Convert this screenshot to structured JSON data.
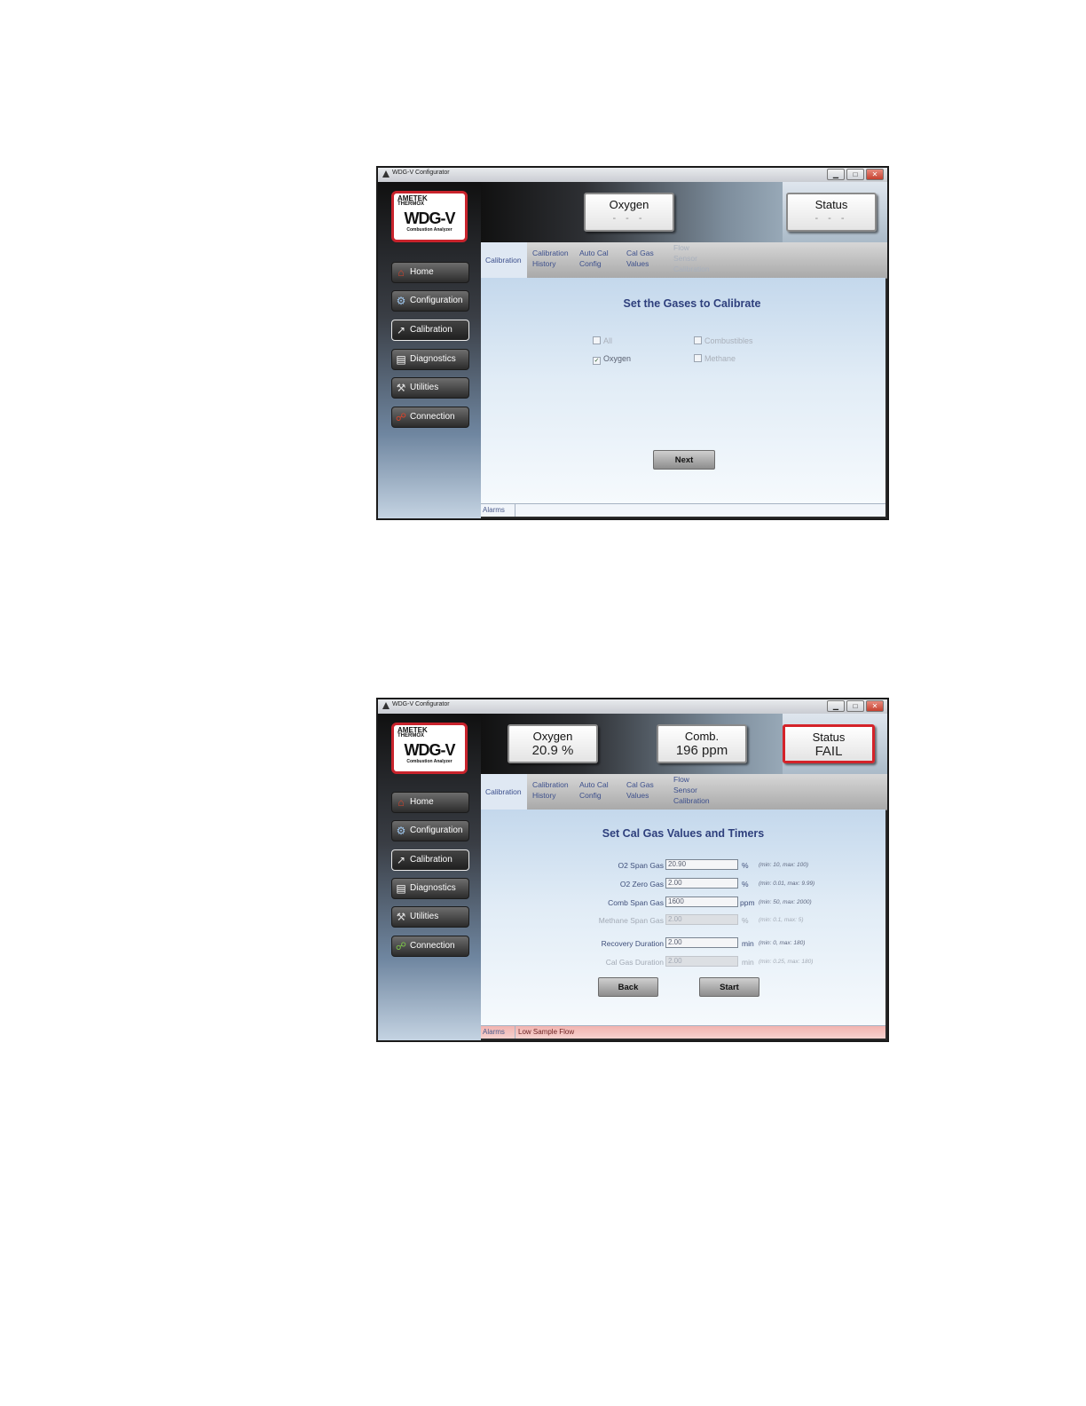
{
  "screen1": {
    "window_title": "WDG-V Configurator",
    "window_buttons": [
      "▁",
      "□",
      "✕"
    ],
    "logo": {
      "brand": "AMETEK",
      "sub": "THERMOX",
      "model": "WDG-V",
      "tagline": "Combustion Analyzer"
    },
    "nav": [
      "Home",
      "Configuration",
      "Calibration",
      "Diagnostics",
      "Utilities",
      "Connection"
    ],
    "header": {
      "oxygen_label": "Oxygen",
      "oxygen_value": "- - -",
      "status_label": "Status",
      "status_value": "- - -"
    },
    "tabs": [
      "Calibration",
      "Calibration History",
      "Auto Cal Config",
      "Cal Gas Values",
      "Flow Sensor Calibration"
    ],
    "main": {
      "title": "Set the Gases to Calibrate",
      "checkboxes": [
        {
          "label": "All",
          "checked": false,
          "enabled": false
        },
        {
          "label": "Combustibles",
          "checked": false,
          "enabled": false
        },
        {
          "label": "Oxygen",
          "checked": true,
          "enabled": true
        },
        {
          "label": "Methane",
          "checked": false,
          "enabled": false
        }
      ],
      "next_label": "Next"
    },
    "alarms_label": "Alarms"
  },
  "screen2": {
    "window_title": "WDG-V Configurator",
    "window_buttons": [
      "▁",
      "□",
      "✕"
    ],
    "logo": {
      "brand": "AMETEK",
      "sub": "THERMOX",
      "model": "WDG-V",
      "tagline": "Combustion Analyzer"
    },
    "nav": [
      "Home",
      "Configuration",
      "Calibration",
      "Diagnostics",
      "Utilities",
      "Connection"
    ],
    "header": {
      "oxygen_label": "Oxygen",
      "oxygen_value": "20.9 %",
      "comb_label": "Comb.",
      "comb_value": "196 ppm",
      "status_label": "Status",
      "status_value": "FAIL"
    },
    "tabs": [
      "Calibration",
      "Calibration History",
      "Auto Cal Config",
      "Cal Gas Values",
      "Flow Sensor Calibration"
    ],
    "main": {
      "title": "Set Cal Gas Values and Timers",
      "fields": [
        {
          "label": "O2 Span Gas",
          "value": "20.90",
          "unit": "%",
          "range": "(min: 10, max: 100)",
          "enabled": true
        },
        {
          "label": "O2 Zero Gas",
          "value": "2.00",
          "unit": "%",
          "range": "(min: 0.01, max: 9.99)",
          "enabled": true
        },
        {
          "label": "Comb Span Gas",
          "value": "1600",
          "unit": "ppm",
          "range": "(min: 50, max: 2000)",
          "enabled": true
        },
        {
          "label": "Methane Span Gas",
          "value": "2.00",
          "unit": "%",
          "range": "(min: 0.1, max: 5)",
          "enabled": false
        },
        {
          "label": "Recovery Duration",
          "value": "2.00",
          "unit": "min",
          "range": "(min: 0, max: 180)",
          "enabled": true
        },
        {
          "label": "Cal Gas Duration",
          "value": "2.00",
          "unit": "min",
          "range": "(min: 0.25, max: 180)",
          "enabled": false
        }
      ],
      "back_label": "Back",
      "start_label": "Start"
    },
    "alarms_label": "Alarms",
    "alarm_message": "Low Sample Flow"
  }
}
